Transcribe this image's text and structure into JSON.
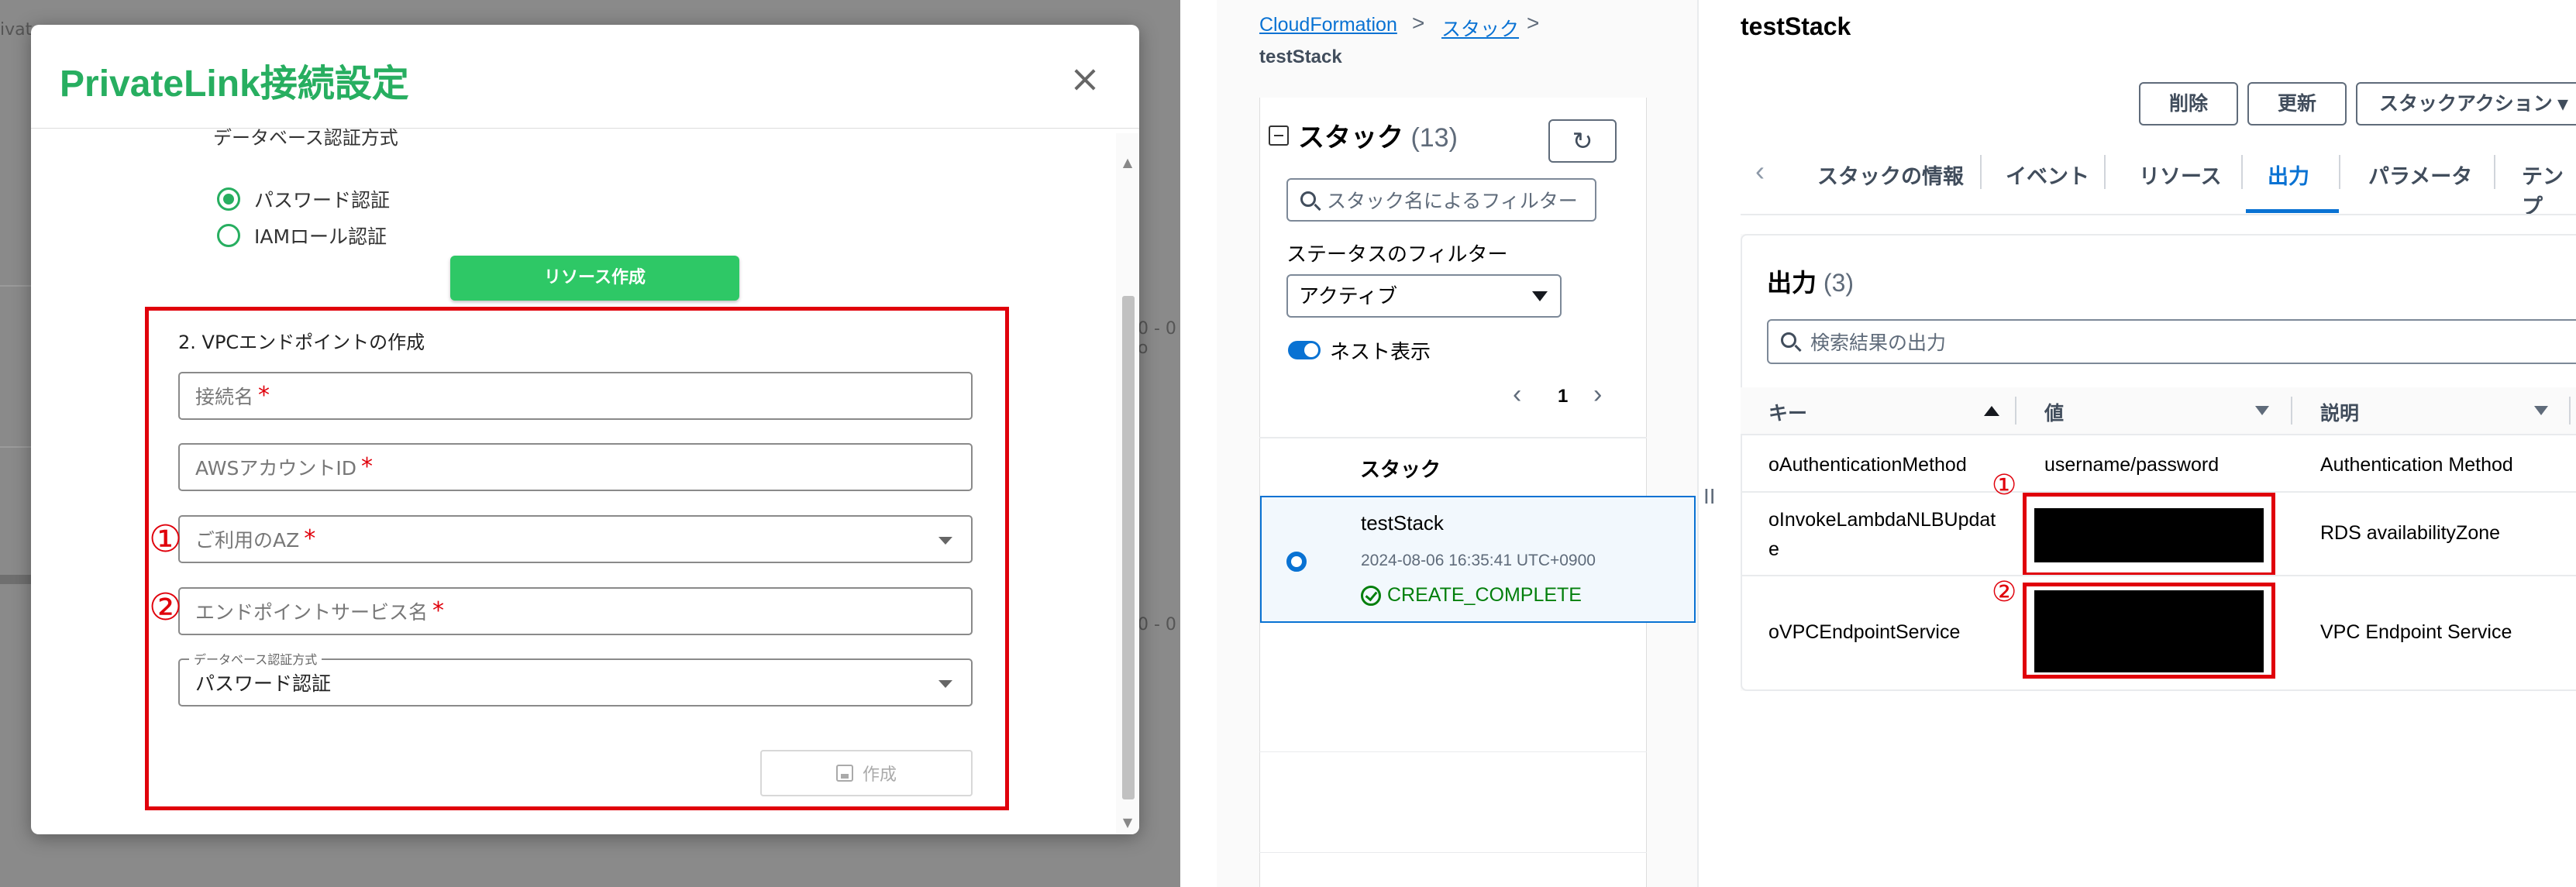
{
  "left": {
    "background_fragments": [
      "ivat",
      "0 - 0 o",
      "0 - 0"
    ],
    "modal": {
      "title": "PrivateLink接続設定",
      "close_glyph": "×",
      "auth_method_label_cut": "データベース認証方式",
      "radio_options": [
        {
          "label": "パスワード認証",
          "selected": true
        },
        {
          "label": "IAMロール認証",
          "selected": false
        }
      ],
      "resource_button": "リソース作成",
      "step2_heading": "2. VPCエンドポイントの作成",
      "fields": {
        "connection_name": "接続名",
        "aws_account_id": "AWSアカウントID",
        "az": "ご利用のAZ",
        "endpoint_service": "エンドポイントサービス名",
        "auth_legend": "データベース認証方式",
        "auth_value": "パスワード認証"
      },
      "required_mark": "*",
      "marker_1": "①",
      "marker_2": "②",
      "create_button": "作成"
    }
  },
  "right": {
    "breadcrumb": {
      "cloudformation": "CloudFormation",
      "separator": ">",
      "stacks": "スタック",
      "current": "testStack"
    },
    "stacks_panel": {
      "heading": "スタック",
      "count": "(13)",
      "refresh_glyph": "↻",
      "search_placeholder": "スタック名によるフィルター",
      "status_filter_label": "ステータスのフィルター",
      "status_filter_value": "アクティブ",
      "nested_label": "ネスト表示",
      "page_prev": "‹",
      "page_number": "1",
      "page_next": "›",
      "column_header": "スタック",
      "row": {
        "name": "testStack",
        "date": "2024-08-06 16:35:41 UTC+0900",
        "status": "CREATE_COMPLETE"
      }
    },
    "splitter_glyph": "II",
    "detail": {
      "title": "testStack",
      "buttons": {
        "delete": "削除",
        "update": "更新",
        "actions": "スタックアクション ▾"
      },
      "tabs_prev": "‹",
      "tabs": [
        "スタックの情報",
        "イベント",
        "リソース",
        "出力",
        "パラメータ",
        "テンプ"
      ],
      "active_tab": "出力",
      "outputs": {
        "heading": "出力",
        "count": "(3)",
        "search_placeholder": "検索結果の出力",
        "columns": {
          "key": "キー",
          "value": "値",
          "description": "説明"
        },
        "rows": [
          {
            "key": "oAuthenticationMethod",
            "value": "username/password",
            "description": "Authentication Method"
          },
          {
            "key": "oInvokeLambdaNLBUpdate",
            "value": "",
            "description": "RDS availabilityZone"
          },
          {
            "key": "oVPCEndpointService",
            "value": "",
            "description": "VPC Endpoint Service"
          }
        ],
        "marker_1": "①",
        "marker_2": "②"
      }
    },
    "colors": {
      "accent": "#0972d3",
      "success": "#037f0c",
      "highlight": "#e0000b",
      "brand_green": "#27ae60"
    }
  }
}
